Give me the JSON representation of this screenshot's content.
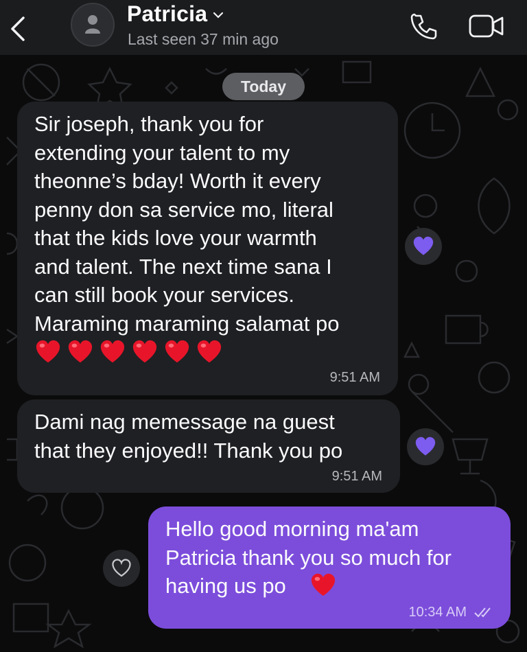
{
  "header": {
    "contact_name": "Patricia",
    "last_seen": "Last seen 37 min ago"
  },
  "date_separator": "Today",
  "messages": [
    {
      "direction": "incoming",
      "text": "Sir joseph, thank you for\nextending your talent to my\ntheonne’s bday! Worth it every\npenny don sa service mo, literal\nthat the kids love your warmth\nand talent. The next time sana I\ncan still book your services.\nMaraming maraming salamat po",
      "emoji": "❤️❤️❤️❤️❤️❤️",
      "time": "9:51 AM",
      "reaction": "purple-heart"
    },
    {
      "direction": "incoming",
      "text": "Dami nag memessage na guest\nthat they enjoyed!! Thank you po",
      "time": "9:51 AM",
      "reaction": "purple-heart"
    },
    {
      "direction": "outgoing",
      "text": "Hello good morning ma'am\nPatricia thank you so much for\nhaving us po",
      "emoji": "❤️",
      "time": "10:34 AM",
      "status": "read"
    }
  ],
  "colors": {
    "header_bg": "#1b1c1e",
    "background": "#0b0b0c",
    "incoming_bubble": "#1f2023",
    "outgoing_bubble": "#7c4ddb",
    "reaction_heart": "#7d5cf0",
    "heart_red": "#e8152a"
  },
  "icons": [
    "back-arrow-icon",
    "avatar-person-icon",
    "chevron-down-icon",
    "phone-icon",
    "video-camera-icon",
    "purple-heart-icon",
    "outline-heart-icon",
    "double-check-icon"
  ]
}
